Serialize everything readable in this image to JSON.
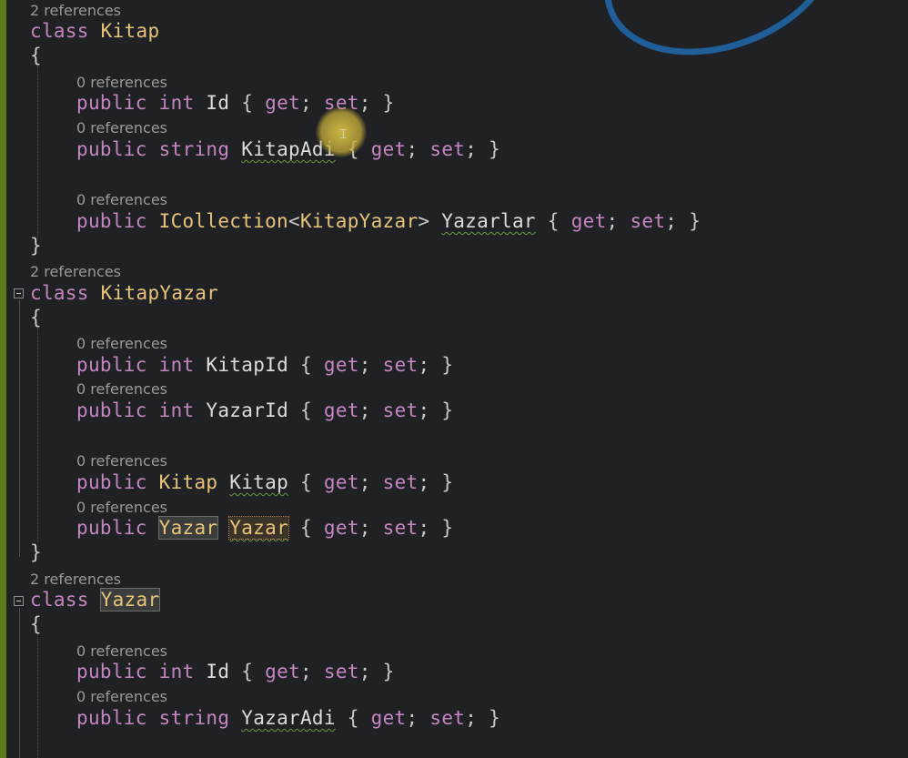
{
  "lens": {
    "class_refs": "2 references",
    "member_refs": "0 references"
  },
  "tokens": {
    "class_kw": "class",
    "public_kw": "public",
    "int_kw": "int",
    "string_kw": "string",
    "get": "get",
    "set": "set",
    "open_brace": "{",
    "close_brace": "}",
    "semicolon": ";",
    "open_angle": "<",
    "close_angle": ">"
  },
  "classes": [
    {
      "name": "Kitap",
      "members": [
        {
          "type": "int",
          "name": "Id"
        },
        {
          "type": "string",
          "name": "KitapAdi"
        },
        {
          "type": "ICollection",
          "generic": "KitapYazar",
          "name": "Yazarlar"
        }
      ]
    },
    {
      "name": "KitapYazar",
      "members": [
        {
          "type": "int",
          "name": "KitapId"
        },
        {
          "type": "int",
          "name": "YazarId"
        },
        {
          "type": "Kitap",
          "name": "Kitap"
        },
        {
          "type": "Yazar",
          "name": "Yazar"
        }
      ]
    },
    {
      "name": "Yazar",
      "members": [
        {
          "type": "int",
          "name": "Id"
        },
        {
          "type": "string",
          "name": "YazarAdi"
        }
      ]
    }
  ],
  "colors": {
    "background": "#1f2125",
    "keyword": "#c586c0",
    "type_name": "#e8c47a",
    "identifier": "#dcdcdc",
    "lens_text": "#9a9a9a",
    "change_bar": "#5d7d1a"
  }
}
